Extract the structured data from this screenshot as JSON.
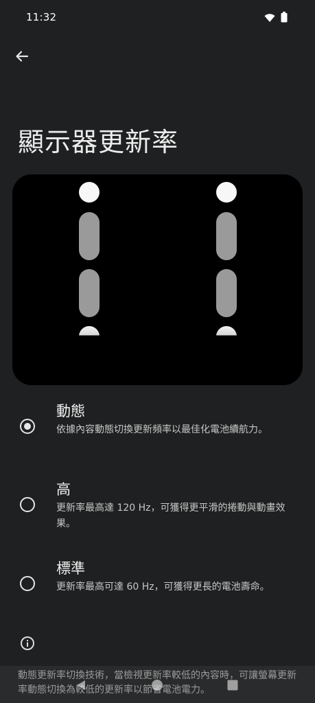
{
  "status_bar": {
    "time": "11:32",
    "icons": [
      "wifi-icon",
      "battery-icon"
    ]
  },
  "header": {
    "back_icon": "arrow-back-icon",
    "title": "顯示器更新率"
  },
  "options": [
    {
      "title": "動態",
      "description": "依據內容動態切換更新頻率以最佳化電池續航力。",
      "selected": true
    },
    {
      "title": "高",
      "description": "更新率最高達 120 Hz，可獲得更平滑的捲動與動畫效果。",
      "selected": false
    },
    {
      "title": "標準",
      "description": "更新率最高可達 60 Hz，可獲得更長的電池壽命。",
      "selected": false
    }
  ],
  "footer": {
    "info_icon": "info-icon",
    "text": "動態更新率切換技術，當檢視更新率較低的內容時，可讓螢幕更新率動態切換為較低的更新率以節省電池電力。"
  },
  "nav": {
    "icons": [
      "back-triangle-icon",
      "home-circle-icon",
      "recents-square-icon"
    ]
  },
  "colors": {
    "background": "#1f2021",
    "preview_bg": "#000000",
    "text_primary": "#efefef",
    "text_secondary": "#c7c7c7"
  }
}
